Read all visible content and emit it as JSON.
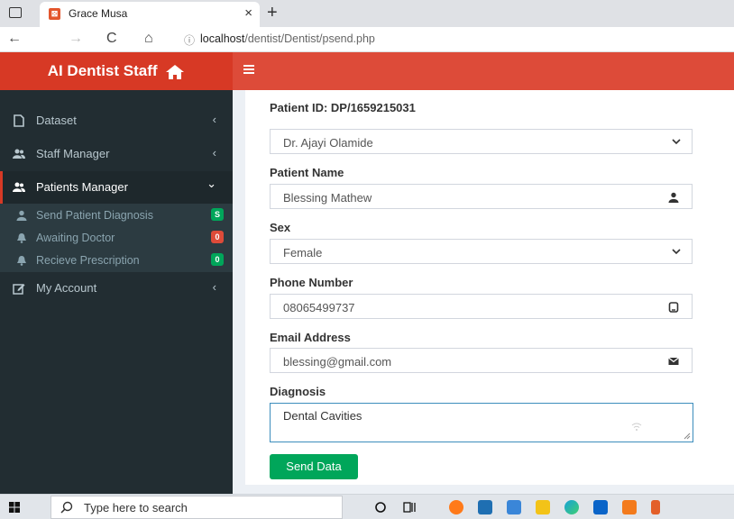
{
  "browser": {
    "tab_title": "Grace Musa",
    "tab_favicon": "xampp-icon",
    "tab_close": "×",
    "new_tab": "+",
    "url_host": "localhost",
    "url_path": "/dentist/Dentist/psend.php",
    "back": "←",
    "forward": "→",
    "reload": "C",
    "home": "⌂",
    "info": "ⓘ"
  },
  "sidebar": {
    "brand": "AI Dentist Staff",
    "items": [
      {
        "label": "Dataset",
        "icon": "file-icon",
        "chevron": "‹"
      },
      {
        "label": "Staff Manager",
        "icon": "users-icon",
        "chevron": "‹"
      },
      {
        "label": "Patients Manager",
        "icon": "users-icon",
        "chevron": "⌄"
      },
      {
        "label": "My Account",
        "icon": "edit-icon",
        "chevron": "‹"
      }
    ],
    "subitems": [
      {
        "label": "Send Patient Diagnosis",
        "icon": "user-icon",
        "badge": "S",
        "badge_color": "#00a65a"
      },
      {
        "label": "Awaiting Doctor",
        "icon": "bell-icon",
        "badge": "0",
        "badge_color": "#dd4b39"
      },
      {
        "label": "Recieve Prescription",
        "icon": "bell-icon",
        "badge": "0",
        "badge_color": "#00a65a"
      }
    ]
  },
  "form": {
    "patient_id": "Patient ID: DP/1659215031",
    "doctor": "Dr. Ajayi Olamide",
    "name_label": "Patient Name",
    "name_value": "Blessing Mathew",
    "sex_label": "Sex",
    "sex_value": "Female",
    "phone_label": "Phone Number",
    "phone_value": "08065499737",
    "email_label": "Email Address",
    "email_value": "blessing@gmail.com",
    "diagnosis_label": "Diagnosis",
    "diagnosis_value": "Dental Cavities",
    "submit": "Send Data"
  },
  "taskbar": {
    "search_placeholder": "Type here to search"
  },
  "colors": {
    "brand_red": "#d73925",
    "topbar_red": "#dd4b39",
    "sidebar_bg": "#222d32",
    "success_green": "#00a65a"
  }
}
